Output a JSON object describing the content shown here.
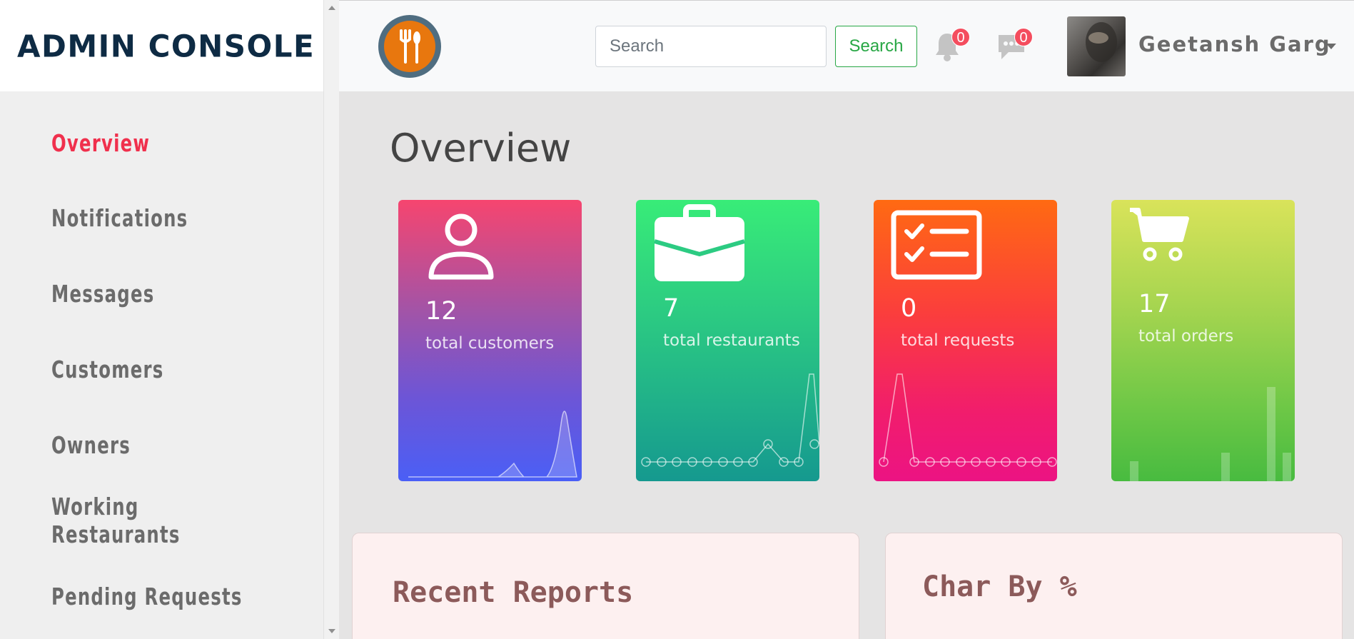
{
  "sidebar": {
    "brand": "ADMIN CONSOLE",
    "items": [
      {
        "label": "Overview",
        "active": true
      },
      {
        "label": "Notifications",
        "active": false
      },
      {
        "label": "Messages",
        "active": false
      },
      {
        "label": "Customers",
        "active": false
      },
      {
        "label": "Owners",
        "active": false
      },
      {
        "label": "Working Restaurants",
        "active": false
      },
      {
        "label": "Pending Requests",
        "active": false
      }
    ]
  },
  "header": {
    "logo_icon": "fork-spoon-logo-icon",
    "search": {
      "placeholder": "Search",
      "button_label": "Search"
    },
    "notifications_count": "0",
    "messages_count": "0",
    "user_name": "Geetansh Garg"
  },
  "main": {
    "title": "Overview",
    "cards": [
      {
        "count": "12",
        "label": "total customers",
        "icon": "user-icon",
        "color": "#f6456f"
      },
      {
        "count": "7",
        "label": "total restaurants",
        "icon": "briefcase-icon",
        "color": "#38ec78"
      },
      {
        "count": "0",
        "label": "total requests",
        "icon": "checklist-icon",
        "color": "#ff6a12"
      },
      {
        "count": "17",
        "label": "total orders",
        "icon": "cart-icon",
        "color": "#d9e35a"
      }
    ],
    "panels": [
      {
        "title": "Recent Reports"
      },
      {
        "title": "Char By %"
      }
    ]
  },
  "colors": {
    "accent_active": "#f0304d",
    "brand_text": "#0e2b44",
    "search_button": "#28a745",
    "badge": "#f44d5e"
  }
}
